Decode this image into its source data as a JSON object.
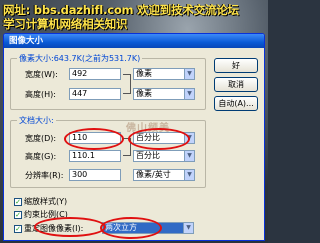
{
  "watermark": {
    "line1": "网址: bbs.dazhifl.com   欢迎到技术交流论坛",
    "line2": "学习计算机网络相关知识"
  },
  "dialog": {
    "title": "图像大小",
    "pixel_section": {
      "legend": "像素大小:643.7K(之前为531.7K)",
      "width_label": "宽度(W):",
      "width_value": "492",
      "width_unit": "像素",
      "height_label": "高度(H):",
      "height_value": "447",
      "height_unit": "像素"
    },
    "doc_section": {
      "legend": "文档大小:",
      "width_label": "宽度(D):",
      "width_value": "110",
      "width_unit": "百分比",
      "height_label": "高度(G):",
      "height_value": "110.1",
      "height_unit": "百分比",
      "res_label": "分辨率(R):",
      "res_value": "300",
      "res_unit": "像素/英寸"
    },
    "stamp": "佛山频美",
    "checkboxes": {
      "scale_styles": "缩放样式(Y)",
      "constrain": "约束比例(C)",
      "resample": "重定图像像素(I):",
      "resample_method": "两次立方"
    },
    "buttons": {
      "ok": "好",
      "cancel": "取消",
      "auto": "自动(A)..."
    },
    "check_mark": "✓",
    "dropdown_arrow": "▼"
  }
}
